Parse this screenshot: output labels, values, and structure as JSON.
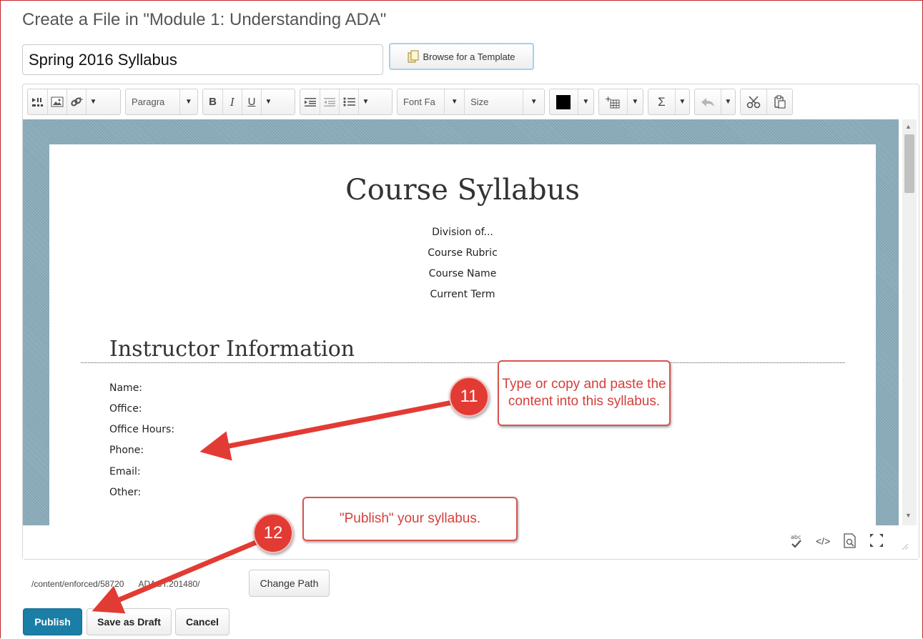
{
  "page_title": "Create a File in \"Module 1: Understanding ADA\"",
  "title_input": {
    "value": "Spring 2016 Syllabus"
  },
  "browse_button": {
    "label": "Browse for a Template"
  },
  "toolbar": {
    "paragraph": "Paragra",
    "bold": "B",
    "italic": "I",
    "underline": "U",
    "font_family": "Font Fa",
    "size": "Size",
    "sigma": "Σ"
  },
  "document": {
    "title": "Course Syllabus",
    "info_lines": [
      "Division of...",
      "Course Rubric",
      "Course Name",
      "Current Term"
    ],
    "section_heading": "Instructor Information",
    "fields": [
      "Name:",
      "Office:",
      "Office Hours:",
      "Phone:",
      "Email:",
      "Other:"
    ]
  },
  "path": {
    "prefix": "/content/enforced/",
    "number": "58720",
    "suffix": "ADACT.201480/",
    "change_label": "Change Path"
  },
  "actions": {
    "publish": "Publish",
    "save_draft": "Save as Draft",
    "cancel": "Cancel"
  },
  "annotations": [
    {
      "number": "11",
      "text": "Type or copy and paste the content into this syllabus."
    },
    {
      "number": "12",
      "text": "\"Publish\" your syllabus."
    }
  ],
  "colors": {
    "accent": "#1a7ea6",
    "annotation_red": "#e23b33",
    "frame": "#c0272d"
  },
  "icons": [
    "insert-stuff-icon",
    "image-icon",
    "link-icon",
    "indent-icon",
    "outdent-icon",
    "bullet-list-icon",
    "color-swatch-icon",
    "table-icon",
    "equation-icon",
    "undo-icon",
    "cut-icon",
    "paste-icon",
    "spellcheck-icon",
    "source-code-icon",
    "preview-icon",
    "fullscreen-icon",
    "template-icon"
  ]
}
